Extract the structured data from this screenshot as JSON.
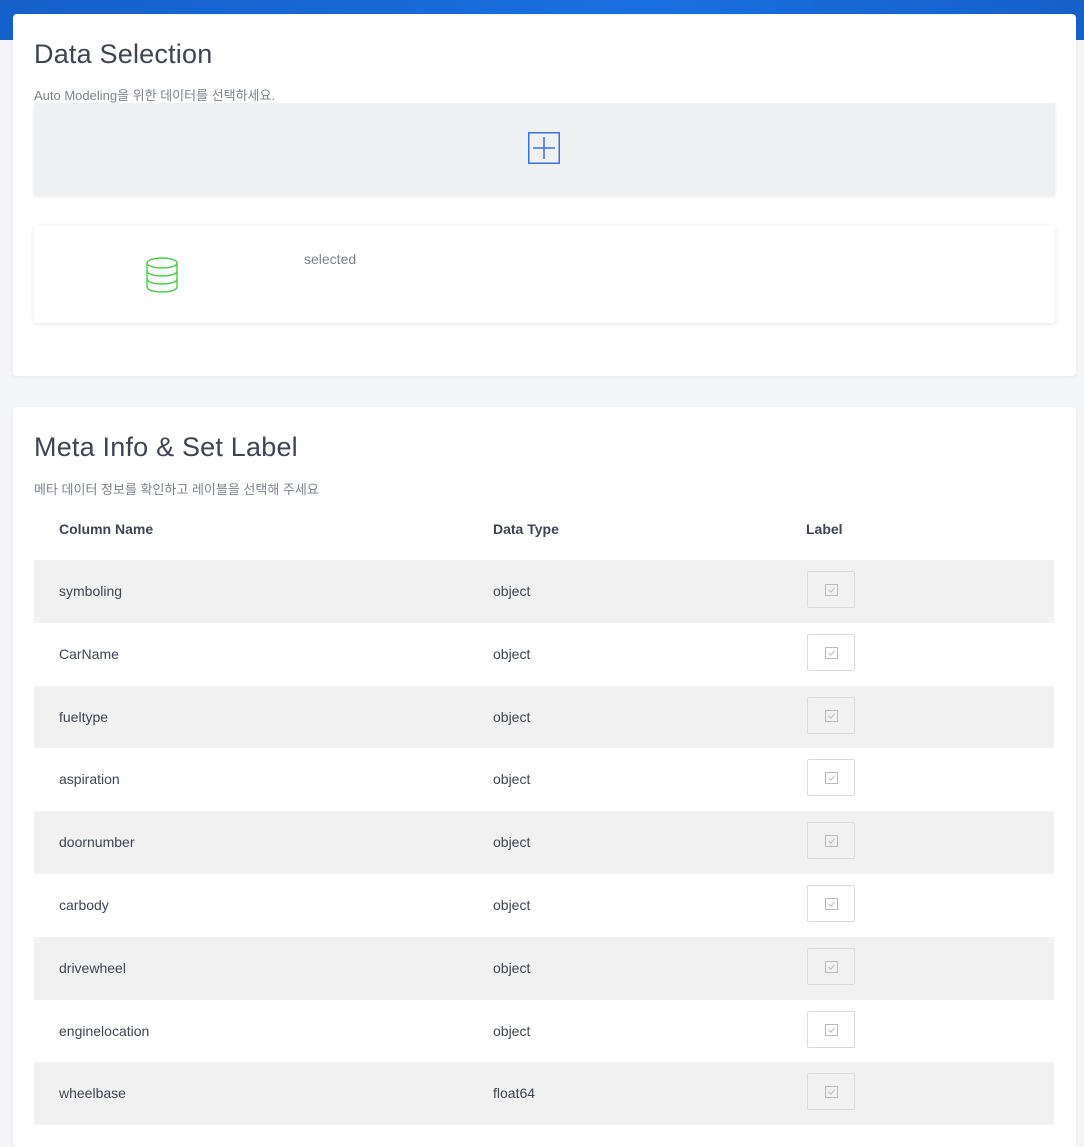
{
  "data_selection": {
    "title": "Data Selection",
    "subtitle": "Auto Modeling을 위한 데이터를 선택하세요.",
    "add_icon": "plus-icon",
    "selected_icon": "database-icon",
    "selected_text": "selected"
  },
  "meta_info": {
    "title": "Meta Info & Set Label",
    "subtitle": "메타 데이터 정보를 확인하고 레이블을 선택해 주세요",
    "columns": [
      "Column Name",
      "Data Type",
      "Label"
    ],
    "rows": [
      {
        "name": "symboling",
        "type": "object",
        "label_checked": false
      },
      {
        "name": "CarName",
        "type": "object",
        "label_checked": false
      },
      {
        "name": "fueltype",
        "type": "object",
        "label_checked": false
      },
      {
        "name": "aspiration",
        "type": "object",
        "label_checked": false
      },
      {
        "name": "doornumber",
        "type": "object",
        "label_checked": false
      },
      {
        "name": "carbody",
        "type": "object",
        "label_checked": false
      },
      {
        "name": "drivewheel",
        "type": "object",
        "label_checked": false
      },
      {
        "name": "enginelocation",
        "type": "object",
        "label_checked": false
      },
      {
        "name": "wheelbase",
        "type": "float64",
        "label_checked": false
      }
    ]
  },
  "colors": {
    "header_blue": "#1a6fe0",
    "plus_icon_blue": "#3b6fd8",
    "database_icon_green": "#4cc94c",
    "row_stripe": "#f1f1f1"
  }
}
